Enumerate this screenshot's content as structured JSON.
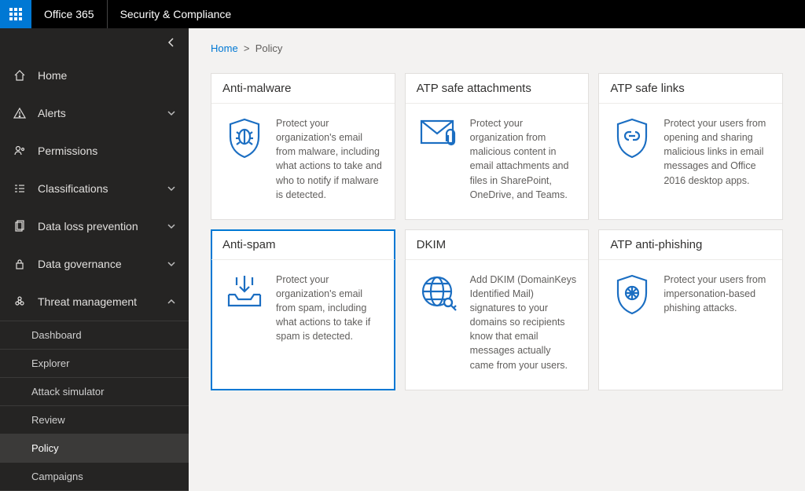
{
  "header": {
    "brand": "Office 365",
    "app": "Security & Compliance"
  },
  "breadcrumb": {
    "home": "Home",
    "sep": ">",
    "current": "Policy"
  },
  "sidebar": {
    "items": [
      {
        "label": "Home"
      },
      {
        "label": "Alerts"
      },
      {
        "label": "Permissions"
      },
      {
        "label": "Classifications"
      },
      {
        "label": "Data loss prevention"
      },
      {
        "label": "Data governance"
      },
      {
        "label": "Threat management"
      }
    ],
    "threat_sub": [
      {
        "label": "Dashboard"
      },
      {
        "label": "Explorer"
      },
      {
        "label": "Attack simulator"
      },
      {
        "label": "Review"
      },
      {
        "label": "Policy"
      },
      {
        "label": "Campaigns"
      }
    ]
  },
  "cards": [
    {
      "title": "Anti-malware",
      "desc": "Protect your organization's email from malware, including what actions to take and who to notify if malware is detected."
    },
    {
      "title": "ATP safe attachments",
      "desc": "Protect your organization from malicious content in email attachments and files in SharePoint, OneDrive, and Teams."
    },
    {
      "title": "ATP safe links",
      "desc": "Protect your users from opening and sharing malicious links in email messages and Office 2016 desktop apps."
    },
    {
      "title": "Anti-spam",
      "desc": "Protect your organization's email from spam, including what actions to take if spam is detected."
    },
    {
      "title": "DKIM",
      "desc": "Add DKIM (DomainKeys Identified Mail) signatures to your domains so recipients know that email messages actually came from your users."
    },
    {
      "title": "ATP anti-phishing",
      "desc": "Protect your users from impersonation-based phishing attacks."
    }
  ]
}
